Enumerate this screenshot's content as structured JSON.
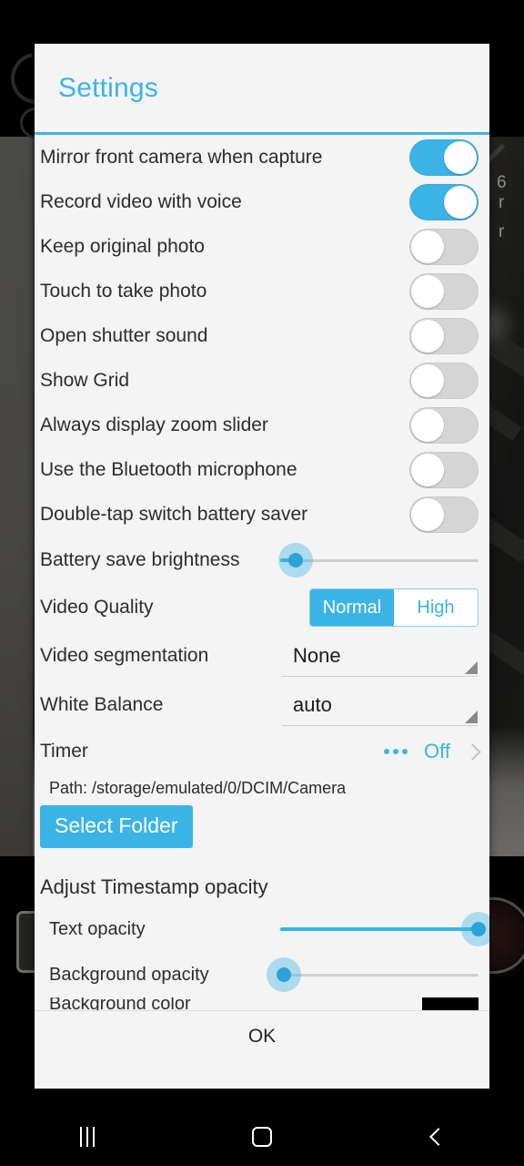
{
  "dialog": {
    "title": "Settings",
    "ok_label": "OK",
    "accent_color": "#3bb4e5",
    "surface_color": "#f4f4f4"
  },
  "toggles": [
    {
      "label": "Mirror front camera when capture",
      "state": "on"
    },
    {
      "label": "Record video with voice",
      "state": "on"
    },
    {
      "label": "Keep original photo",
      "state": "off"
    },
    {
      "label": "Touch to take photo",
      "state": "off"
    },
    {
      "label": "Open shutter sound",
      "state": "off"
    },
    {
      "label": "Show Grid",
      "state": "off"
    },
    {
      "label": "Always display zoom slider",
      "state": "off"
    },
    {
      "label": "Use the Bluetooth microphone",
      "state": "off"
    },
    {
      "label": "Double-tap switch battery saver",
      "state": "off"
    }
  ],
  "brightness": {
    "label": "Battery save brightness",
    "percent": 8
  },
  "video_quality": {
    "label": "Video Quality",
    "options": [
      "Normal",
      "High"
    ],
    "selected": "Normal"
  },
  "video_segmentation": {
    "label": "Video segmentation",
    "value": "None"
  },
  "white_balance": {
    "label": "White Balance",
    "value": "auto"
  },
  "timer": {
    "label": "Timer",
    "value": "Off",
    "more_icon": "overflow-dots-icon",
    "chevron_icon": "chevron-right-icon"
  },
  "storage": {
    "path_text": "Path: /storage/emulated/0/DCIM/Camera",
    "select_folder_label": "Select Folder"
  },
  "timestamp": {
    "section_title": "Adjust Timestamp opacity",
    "text_opacity": {
      "label": "Text opacity",
      "percent": 100
    },
    "background_opacity": {
      "label": "Background opacity",
      "percent": 2
    },
    "background_color": {
      "label": "Background color",
      "value": "#000000"
    }
  },
  "navbar": {
    "recents_label": "Recents",
    "home_label": "Home",
    "back_label": "Back"
  }
}
